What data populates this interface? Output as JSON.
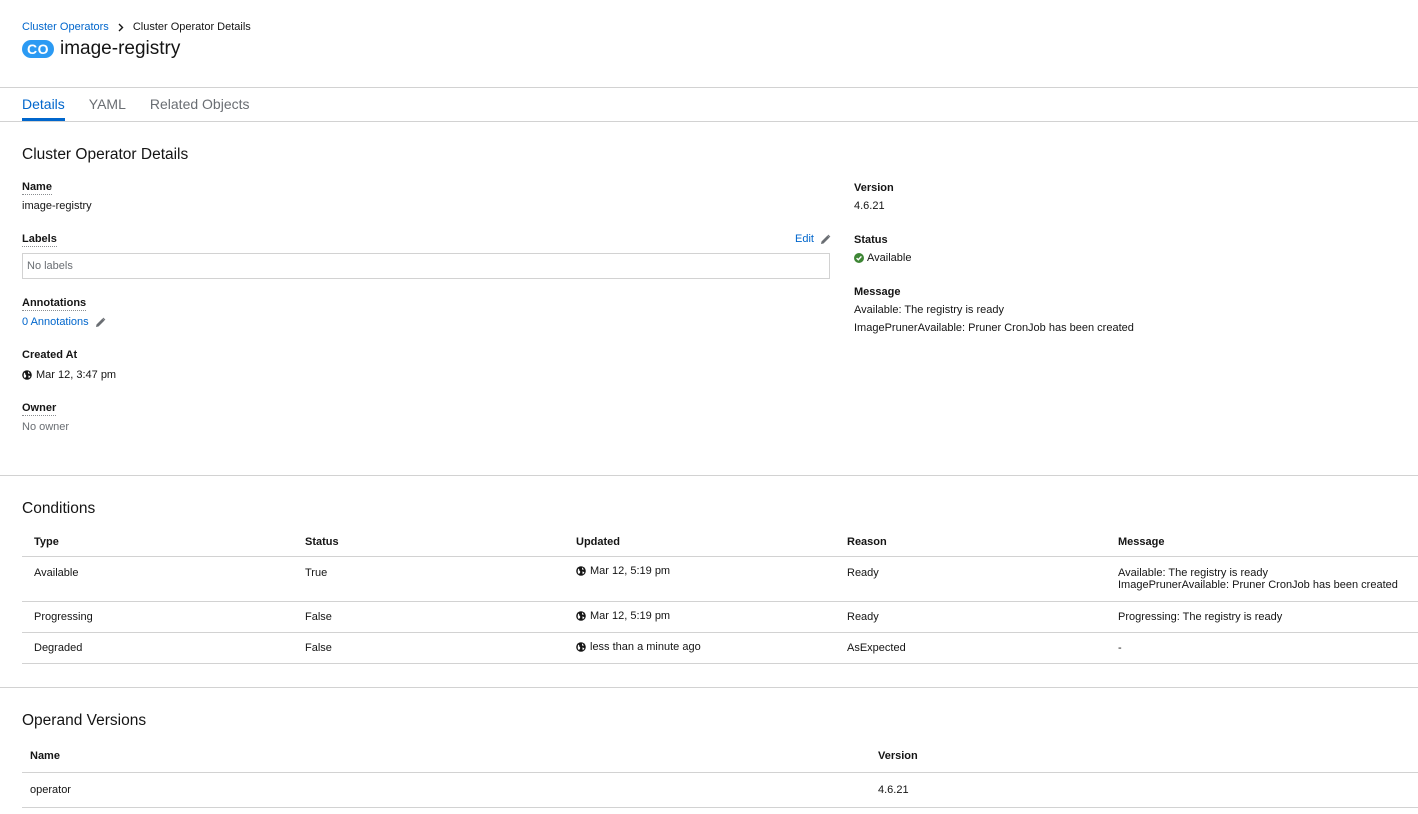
{
  "breadcrumb": {
    "parent": "Cluster Operators",
    "current": "Cluster Operator Details"
  },
  "resource": {
    "badge": "CO",
    "name": "image-registry"
  },
  "tabs": [
    {
      "label": "Details"
    },
    {
      "label": "YAML"
    },
    {
      "label": "Related Objects"
    }
  ],
  "details": {
    "heading": "Cluster Operator Details",
    "name_label": "Name",
    "name_value": "image-registry",
    "labels_label": "Labels",
    "labels_edit": "Edit",
    "labels_empty": "No labels",
    "annotations_label": "Annotations",
    "annotations_link": "0 Annotations",
    "created_label": "Created At",
    "created_value": "Mar 12, 3:47 pm",
    "owner_label": "Owner",
    "owner_value": "No owner",
    "version_label": "Version",
    "version_value": "4.6.21",
    "status_label": "Status",
    "status_value": "Available",
    "message_label": "Message",
    "message_line1": "Available: The registry is ready",
    "message_line2": "ImagePrunerAvailable: Pruner CronJob has been created"
  },
  "conditions": {
    "heading": "Conditions",
    "columns": [
      "Type",
      "Status",
      "Updated",
      "Reason",
      "Message"
    ],
    "rows": [
      {
        "type": "Available",
        "status": "True",
        "updated": "Mar 12, 5:19 pm",
        "reason": "Ready",
        "message1": "Available: The registry is ready",
        "message2": "ImagePrunerAvailable: Pruner CronJob has been created"
      },
      {
        "type": "Progressing",
        "status": "False",
        "updated": "Mar 12, 5:19 pm",
        "reason": "Ready",
        "message1": "Progressing: The registry is ready",
        "message2": ""
      },
      {
        "type": "Degraded",
        "status": "False",
        "updated": "less than a minute ago",
        "reason": "AsExpected",
        "message1": "-",
        "message2": ""
      }
    ]
  },
  "operand": {
    "heading": "Operand Versions",
    "columns": [
      "Name",
      "Version"
    ],
    "rows": [
      {
        "name": "operator",
        "version": "4.6.21"
      }
    ]
  },
  "colors": {
    "accent": "#0066cc",
    "badge": "#2b9af3",
    "success": "#3e8635"
  },
  "icons": {
    "globe": "globe-icon",
    "pencil": "pencil-icon",
    "check": "check-circle-icon",
    "chevron": "chevron-right-icon"
  }
}
